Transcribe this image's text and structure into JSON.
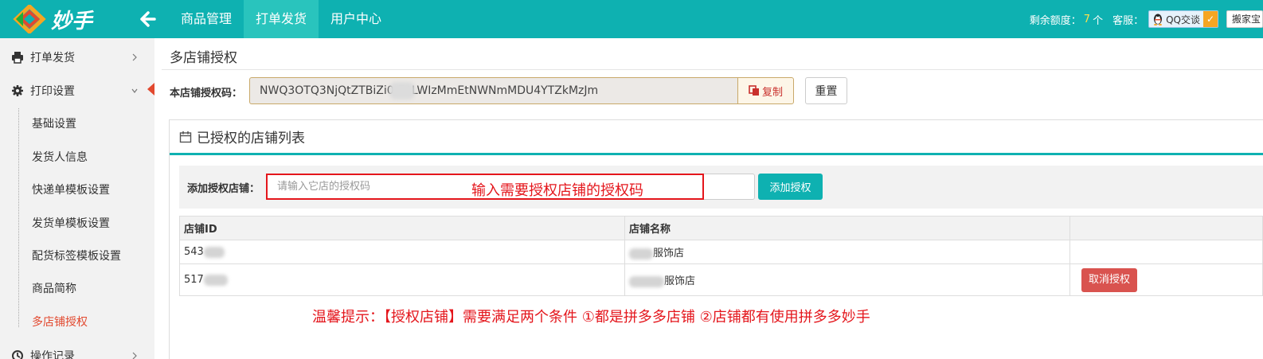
{
  "header": {
    "logo_text": "妙手",
    "nav": [
      {
        "label": "商品管理",
        "active": false
      },
      {
        "label": "打单发货",
        "active": true
      },
      {
        "label": "用户中心",
        "active": false
      }
    ],
    "quota_label": "剩余额度：",
    "quota_value": "7",
    "quota_unit": "个",
    "kefu_label": "客服：",
    "qq_label": "QQ交谈",
    "move_label": "搬家宝"
  },
  "sidebar": {
    "items": [
      {
        "label": "打单发货",
        "icon": "printer-icon"
      },
      {
        "label": "打印设置",
        "icon": "gear-icon"
      },
      {
        "label": "操作记录",
        "icon": "history-icon"
      }
    ],
    "sub_items": [
      {
        "label": "基础设置",
        "active": false
      },
      {
        "label": "发货人信息",
        "active": false
      },
      {
        "label": "快递单模板设置",
        "active": false
      },
      {
        "label": "发货单模板设置",
        "active": false
      },
      {
        "label": "配货标签模板设置",
        "active": false
      },
      {
        "label": "商品简称",
        "active": false
      },
      {
        "label": "多店铺授权",
        "active": true
      }
    ]
  },
  "main": {
    "page_title": "多店铺授权",
    "code_label": "本店铺授权码：",
    "code_value": "NWQ3OTQ3NjQtZTBiZi0       E0LWIzMmEtNWNmMDU4YTZkMzJm",
    "copy_label": "复制",
    "reset_label": "重置",
    "panel_title": "已授权的店铺列表",
    "add_label": "添加授权店铺：",
    "add_placeholder": "请输入它店的授权码",
    "add_button": "添加授权",
    "annotation": "输入需要授权店铺的授权码",
    "table": {
      "headers": [
        "店铺ID",
        "店铺名称",
        ""
      ],
      "rows": [
        {
          "id": "543",
          "name": "服饰店",
          "action": ""
        },
        {
          "id": "517",
          "name": "服饰店",
          "action": "取消授权"
        }
      ]
    },
    "tip": "温馨提示：【授权店铺】需要满足两个条件 ①都是拼多多店铺  ②店铺都有使用拼多多妙手"
  },
  "colors": {
    "primary": "#0eb1b1",
    "nav_active": "#29c4bd",
    "accent_red": "#e4161c",
    "danger": "#d9534f",
    "quota": "#ffe04b"
  }
}
